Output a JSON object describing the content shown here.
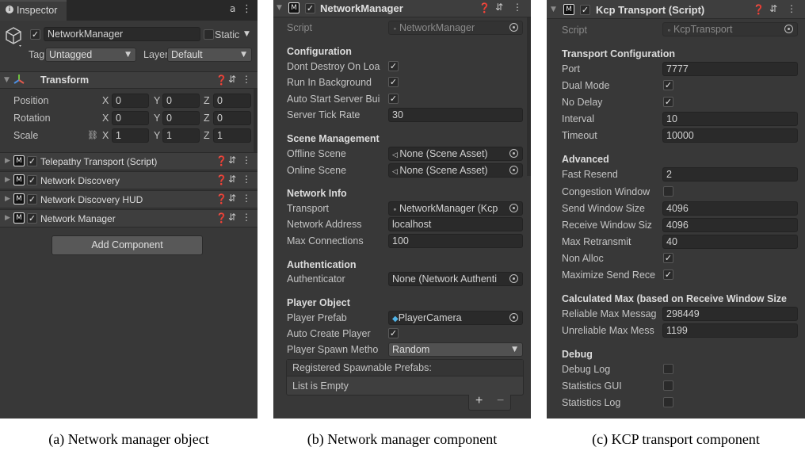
{
  "panel_a": {
    "tab_label": "Inspector",
    "go_name": "NetworkManager",
    "static_label": "Static",
    "tag_label": "Tag",
    "tag_value": "Untagged",
    "layer_label": "Layer",
    "layer_value": "Default",
    "transform_title": "Transform",
    "rows": [
      {
        "label": "Position",
        "x": "0",
        "y": "0",
        "z": "0"
      },
      {
        "label": "Rotation",
        "x": "0",
        "y": "0",
        "z": "0"
      },
      {
        "label": "Scale",
        "x": "1",
        "y": "1",
        "z": "1"
      }
    ],
    "axis_x": "X",
    "axis_y": "Y",
    "axis_z": "Z",
    "components": [
      "Telepathy Transport (Script)",
      "Network Discovery",
      "Network Discovery HUD",
      "Network Manager"
    ],
    "add_component": "Add Component"
  },
  "panel_b": {
    "title": "NetworkManager",
    "script_label": "Script",
    "script_value": "NetworkManager",
    "config_section": "Configuration",
    "dont_destroy": "Dont Destroy On Loa",
    "run_background": "Run In Background",
    "auto_start": "Auto Start Server Bui",
    "tick_rate_label": "Server Tick Rate",
    "tick_rate_value": "30",
    "scene_section": "Scene Management",
    "offline_label": "Offline Scene",
    "offline_value": "None (Scene Asset)",
    "online_label": "Online Scene",
    "online_value": "None (Scene Asset)",
    "netinfo_section": "Network Info",
    "transport_label": "Transport",
    "transport_value": "NetworkManager (Kcp",
    "address_label": "Network Address",
    "address_value": "localhost",
    "maxconn_label": "Max Connections",
    "maxconn_value": "100",
    "auth_section": "Authentication",
    "authenticator_label": "Authenticator",
    "authenticator_value": "None (Network Authenti",
    "player_section": "Player Object",
    "prefab_label": "Player Prefab",
    "prefab_value": "PlayerCamera",
    "auto_create_label": "Auto Create Player",
    "spawn_method_label": "Player Spawn Metho",
    "spawn_method_value": "Random",
    "spawnable_header": "Registered Spawnable Prefabs:",
    "spawnable_empty": "List is Empty",
    "plus": "+",
    "minus": "−"
  },
  "panel_c": {
    "title": "Kcp Transport (Script)",
    "script_label": "Script",
    "script_value": "KcpTransport",
    "transport_section": "Transport Configuration",
    "port_label": "Port",
    "port_value": "7777",
    "dual_label": "Dual Mode",
    "nodelay_label": "No Delay",
    "interval_label": "Interval",
    "interval_value": "10",
    "timeout_label": "Timeout",
    "timeout_value": "10000",
    "advanced_section": "Advanced",
    "fast_resend_label": "Fast Resend",
    "fast_resend_value": "2",
    "congestion_label": "Congestion Window",
    "send_window_label": "Send Window Size",
    "send_window_value": "4096",
    "recv_window_label": "Receive Window Siz",
    "recv_window_value": "4096",
    "max_retransmit_label": "Max Retransmit",
    "max_retransmit_value": "40",
    "non_alloc_label": "Non Alloc",
    "max_send_label": "Maximize Send Rece",
    "calc_section": "Calculated Max (based on Receive Window Size",
    "reliable_label": "Reliable Max Messag",
    "reliable_value": "298449",
    "unreliable_label": "Unreliable Max Mess",
    "unreliable_value": "1199",
    "debug_section": "Debug",
    "debug_log_label": "Debug Log",
    "stats_gui_label": "Statistics GUI",
    "stats_log_label": "Statistics Log"
  },
  "captions": {
    "a": "(a) Network manager object",
    "b": "(b) Network manager component",
    "c": "(c) KCP transport component"
  },
  "check_mark": "✓"
}
